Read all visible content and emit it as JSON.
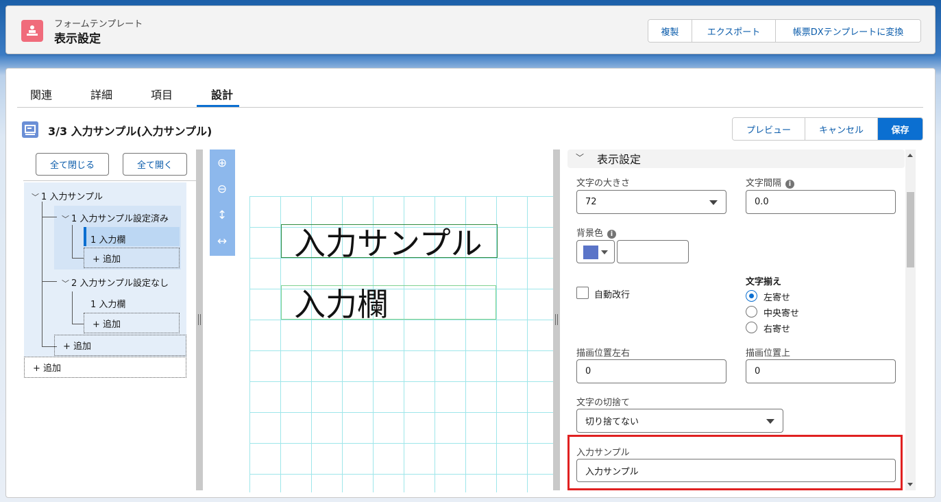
{
  "header": {
    "subtitle": "フォームテンプレート",
    "title": "表示設定",
    "actions": [
      "複製",
      "エクスポート",
      "帳票DXテンプレートに変換"
    ]
  },
  "tabs": [
    {
      "label": "関連",
      "active": false
    },
    {
      "label": "詳細",
      "active": false
    },
    {
      "label": "項目",
      "active": false
    },
    {
      "label": "設計",
      "active": true
    }
  ],
  "section": {
    "title": "3/3 入力サンプル(入力サンプル)",
    "actions": {
      "preview": "プレビュー",
      "cancel": "キャンセル",
      "save": "保存"
    }
  },
  "tree": {
    "collapse_all": "全て閉じる",
    "expand_all": "全て開く",
    "root": "1 入力サンプル",
    "group1": "1 入力サンプル設定済み",
    "group1_item": "1 入力欄",
    "group1_add": "+ 追加",
    "group2": "2 入力サンプル設定なし",
    "group2_item": "1 入力欄",
    "group2_add": "+ 追加",
    "root_add": "+ 追加",
    "top_add": "+ 追加"
  },
  "canvas": {
    "fields": [
      "入力サンプル",
      "入力欄"
    ]
  },
  "properties": {
    "section_title": "表示設定",
    "font_size_label": "文字の大きさ",
    "font_size_value": "72",
    "char_spacing_label": "文字間隔",
    "char_spacing_value": "0.0",
    "bg_color_label": "背景色",
    "bg_color_value": "",
    "swatch_color": "#5a74c8",
    "auto_wrap_label": "自動改行",
    "auto_wrap_checked": false,
    "align_label": "文字揃え",
    "align_options": [
      "左寄せ",
      "中央寄せ",
      "右寄せ"
    ],
    "align_selected": "左寄せ",
    "pos_x_label": "描画位置左右",
    "pos_x_value": "0",
    "pos_y_label": "描画位置上",
    "pos_y_value": "0",
    "truncate_label": "文字の切捨て",
    "truncate_value": "切り捨てない",
    "sample_label": "入力サンプル",
    "sample_value": "入力サンプル"
  },
  "colors": {
    "brand": "#0b6fd1",
    "highlight": "#e02020",
    "icon_header": "#f06b7b"
  }
}
